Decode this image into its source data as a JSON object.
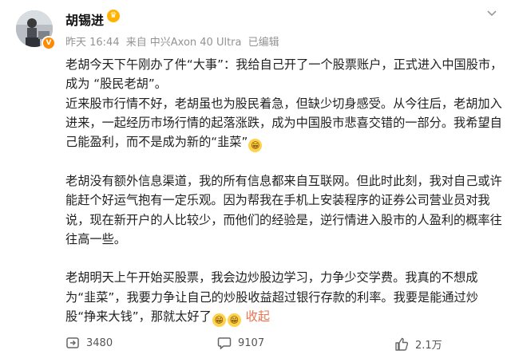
{
  "post": {
    "author": "胡锡进",
    "time": "昨天 16:44",
    "source_prefix": "来自",
    "source": "中兴Axon 40 Ultra",
    "edited": "已编辑",
    "paragraphs": [
      {
        "text": "老胡今天下午刚办了件“大事”：我给自己开了一个股票账户，正式进入中国股市，成为 “股民老胡”。",
        "emojis": 0
      },
      {
        "text": "近来股市行情不好，老胡虽也为股民着急，但缺少切身感受。从今往后，老胡加入进来，一起经历市场行情的起落涨跌，成为中国股市悲喜交错的一部分。我希望自己能盈利，而不是成为新的“韭菜”",
        "emojis": 1
      },
      {
        "text": "老胡没有额外信息渠道，我的所有信息都来自互联网。但此时此刻，我对自己或许能赶个好运气抱有一定乐观。因为帮我在手机上安装程序的证券公司营业员对我说，现在新开户的人比较少，而他们的经验是，逆行情进入股市的人盈利的概率往往高一些。",
        "emojis": 0,
        "gap_before": true
      },
      {
        "text": "老胡明天上午开始买股票，我会边炒股边学习，力争少交学费。我真的不想成为“韭菜”，我要力争让自己的炒股收益超过银行存款的利率。我要是能通过炒股“挣来大钱”，那就太好了",
        "emojis": 2,
        "gap_before": true,
        "collapse": "收起"
      }
    ],
    "stats": {
      "reposts": "3480",
      "comments": "9107",
      "likes": "2.1万"
    },
    "icons": {
      "repost": "repost-icon",
      "comment": "comment-icon",
      "like": "thumbs-up-icon",
      "more": "chevron-down-icon",
      "emoji": "grin-emoji-icon"
    },
    "colors": {
      "accent": "#eb7350",
      "meta": "#939393"
    }
  }
}
